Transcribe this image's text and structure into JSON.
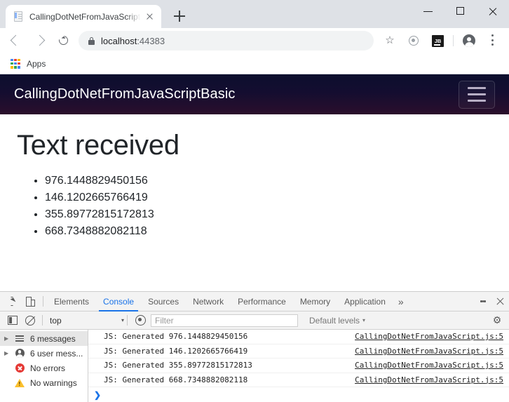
{
  "browser": {
    "tab": {
      "title": "CallingDotNetFromJavaScriptBas",
      "favicon_icon": "page-icon",
      "close_icon": "close-icon"
    },
    "new_tab_icon": "plus-icon",
    "window_controls": {
      "minimize_icon": "minimize-icon",
      "maximize_icon": "maximize-icon",
      "close_icon": "close-icon"
    },
    "toolbar": {
      "back_icon": "back-arrow-icon",
      "forward_icon": "forward-arrow-icon",
      "reload_icon": "reload-icon",
      "lock_icon": "lock-icon",
      "url_host": "localhost",
      "url_port": ":44383",
      "bookmark_icon": "star-icon",
      "extension_icon": "extension-circle-icon",
      "jetbrains_label": "JB",
      "profile_icon": "avatar-icon",
      "menu_icon": "kebab-menu-icon"
    },
    "bookmarks_bar": {
      "apps_label": "Apps",
      "apps_icon": "apps-grid-icon"
    }
  },
  "page": {
    "navbar": {
      "brand": "CallingDotNetFromJavaScriptBasic",
      "toggle_icon": "hamburger-icon",
      "gradient_top": "#0c0f2e",
      "gradient_bottom": "#2b0f2c"
    },
    "heading": "Text received",
    "list_items": [
      "976.1448829450156",
      "146.1202665766419",
      "355.89772815172813",
      "668.7348882082118"
    ]
  },
  "devtools": {
    "tabbar": {
      "inspect_icon": "inspect-element-icon",
      "device_icon": "device-toolbar-icon",
      "tabs": [
        {
          "label": "Elements",
          "active": false
        },
        {
          "label": "Console",
          "active": true
        },
        {
          "label": "Sources",
          "active": false
        },
        {
          "label": "Network",
          "active": false
        },
        {
          "label": "Performance",
          "active": false
        },
        {
          "label": "Memory",
          "active": false
        },
        {
          "label": "Application",
          "active": false
        }
      ],
      "more_label": "»",
      "menu_icon": "kebab-menu-icon",
      "close_icon": "close-icon",
      "active_color": "#1a73e8"
    },
    "filterbar": {
      "sidebar_toggle_icon": "console-sidebar-icon",
      "clear_icon": "clear-console-icon",
      "context_value": "top",
      "context_caret": "▾",
      "live_expression_icon": "eye-icon",
      "filter_placeholder": "Filter",
      "filter_value": "",
      "levels_label": "Default levels",
      "levels_caret": "▾",
      "settings_icon": "gear-icon"
    },
    "sidebar": [
      {
        "label": "6 messages",
        "icon": "list-icon",
        "expandable": true,
        "selected": true
      },
      {
        "label": "6 user mess...",
        "icon": "user-icon",
        "expandable": true,
        "selected": false
      },
      {
        "label": "No errors",
        "icon": "error-icon",
        "expandable": false,
        "selected": false
      },
      {
        "label": "No warnings",
        "icon": "warning-icon",
        "expandable": false,
        "selected": false
      }
    ],
    "messages": [
      {
        "text": "JS: Generated 976.1448829450156",
        "source": "CallingDotNetFromJavaScript.js:5"
      },
      {
        "text": "JS: Generated 146.1202665766419",
        "source": "CallingDotNetFromJavaScript.js:5"
      },
      {
        "text": "JS: Generated 355.89772815172813",
        "source": "CallingDotNetFromJavaScript.js:5"
      },
      {
        "text": "JS: Generated 668.7348882082118",
        "source": "CallingDotNetFromJavaScript.js:5"
      }
    ],
    "prompt_caret": "❯"
  }
}
